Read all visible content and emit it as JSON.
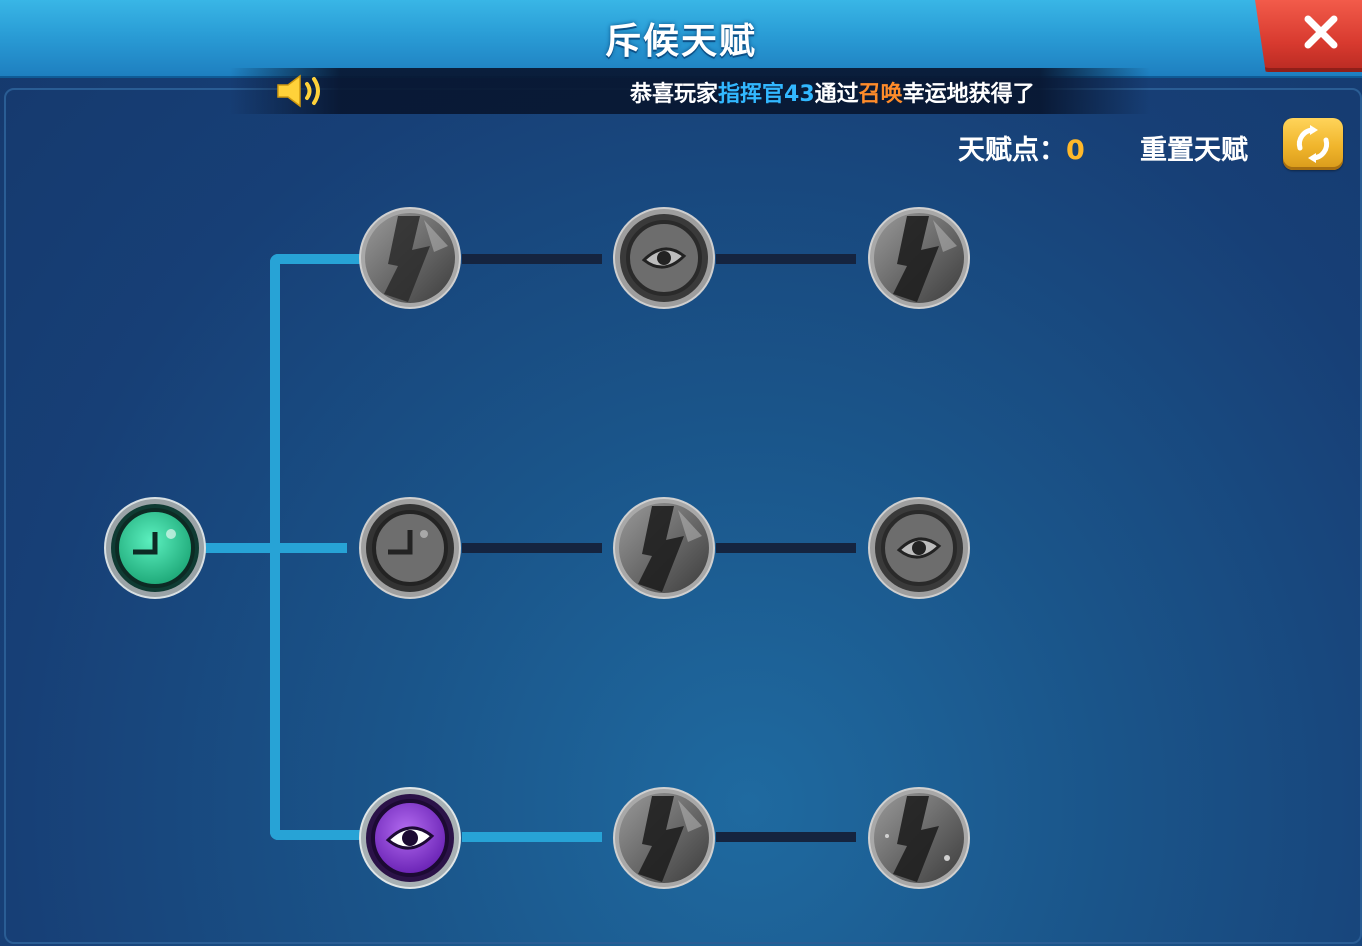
{
  "header": {
    "title": "斥候天赋"
  },
  "ticker": {
    "prefix": "恭喜玩家",
    "player": "指挥官43",
    "middle": "通过",
    "method": "召唤",
    "suffix": "幸运地获得了"
  },
  "talent_points": {
    "label": "天赋点：",
    "value": "0"
  },
  "reset": {
    "label": "重置天赋"
  },
  "colors": {
    "header_blue": "#2a9dd6",
    "close_red": "#d83a2f",
    "accent_blue": "#32b8ff",
    "accent_orange": "#ff8c2a",
    "gold": "#f0b52c",
    "active_green": "#2fd39a",
    "active_purple": "#8a3fd0",
    "path_blue": "#27a3d6"
  },
  "nodes": [
    {
      "name": "root-talent",
      "icon": "clock-icon",
      "state": "active-green"
    },
    {
      "name": "row1-col1",
      "icon": "locked-talent-icon",
      "state": "locked"
    },
    {
      "name": "row1-col2",
      "icon": "eye-target-icon",
      "state": "locked"
    },
    {
      "name": "row1-col3",
      "icon": "locked-talent-icon",
      "state": "locked"
    },
    {
      "name": "row2-col1",
      "icon": "clock-icon",
      "state": "locked"
    },
    {
      "name": "row2-col2",
      "icon": "locked-talent-icon",
      "state": "locked"
    },
    {
      "name": "row2-col3",
      "icon": "eye-target-icon",
      "state": "locked"
    },
    {
      "name": "row3-col1",
      "icon": "eye-target-icon",
      "state": "active-purple"
    },
    {
      "name": "row3-col2",
      "icon": "locked-talent-icon",
      "state": "locked"
    },
    {
      "name": "row3-col3",
      "icon": "locked-talent-icon",
      "state": "locked"
    }
  ]
}
